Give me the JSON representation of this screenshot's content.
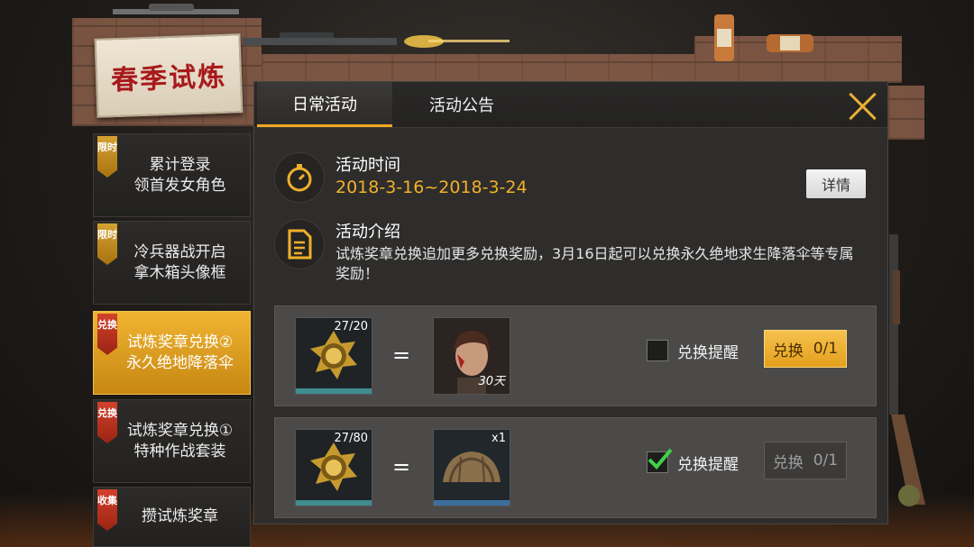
{
  "event_logo": "春季试炼",
  "nav": [
    {
      "tag": "限时",
      "label": "累计登录\n领首发女角色",
      "active": false
    },
    {
      "tag": "限时",
      "label": "冷兵器战开启\n拿木箱头像框",
      "active": false
    },
    {
      "tag": "兑换",
      "label": "试炼奖章兑换②\n永久绝地降落伞",
      "active": true
    },
    {
      "tag": "兑换",
      "label": "试炼奖章兑换①\n特种作战套装",
      "active": false
    },
    {
      "tag": "收集",
      "label": "攒试炼奖章",
      "active": false
    }
  ],
  "tabs": {
    "daily": "日常活动",
    "notice": "活动公告"
  },
  "activity_time": {
    "title": "活动时间",
    "value": "2018-3-16~2018-3-24"
  },
  "detail_button": "详情",
  "activity_intro": {
    "title": "活动介绍",
    "desc": "试炼奖章兑换追加更多兑换奖励，3月16日起可以兑换永久绝地求生降落伞等专属奖励！"
  },
  "exchanges": [
    {
      "medal_count": "27/20",
      "equals": "=",
      "reward_label": "30天",
      "remind_label": "兑换提醒",
      "remind_checked": false,
      "button": "兑换",
      "limit": "0/1",
      "enabled": true
    },
    {
      "medal_count": "27/80",
      "equals": "=",
      "reward_label": "x1",
      "remind_label": "兑换提醒",
      "remind_checked": true,
      "button": "兑换",
      "limit": "0/1",
      "enabled": false
    }
  ],
  "colors": {
    "accent": "#f0a823",
    "active_nav": "#e8a421",
    "panel": "#2e2d2c",
    "date": "#f1b129"
  },
  "icons": [
    "stopwatch-icon",
    "document-icon",
    "medal-icon",
    "close-icon",
    "checkmark-icon"
  ]
}
